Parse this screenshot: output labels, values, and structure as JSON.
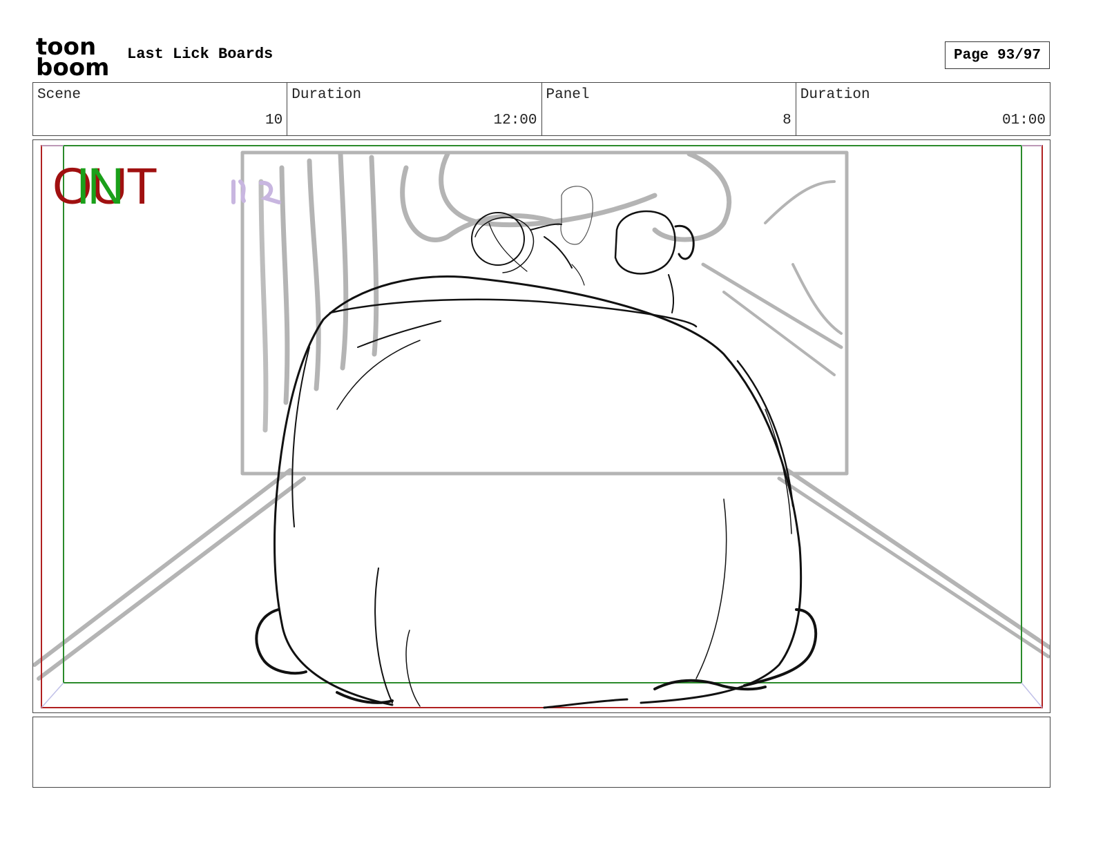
{
  "header": {
    "logo_text_top": "toon",
    "logo_text_bottom": "boom",
    "title": "Last Lick Boards",
    "page": "Page 93/97"
  },
  "info": {
    "scene_label": "Scene",
    "scene_value": "10",
    "scene_duration_label": "Duration",
    "scene_duration_value": "12:00",
    "panel_label": "Panel",
    "panel_value": "8",
    "panel_duration_label": "Duration",
    "panel_duration_value": "01:00"
  },
  "panel": {
    "out_label": "OUT",
    "in_label": "IN",
    "out_color": "#a01010",
    "in_color": "#1aa01a"
  },
  "notes": {
    "text": ""
  }
}
